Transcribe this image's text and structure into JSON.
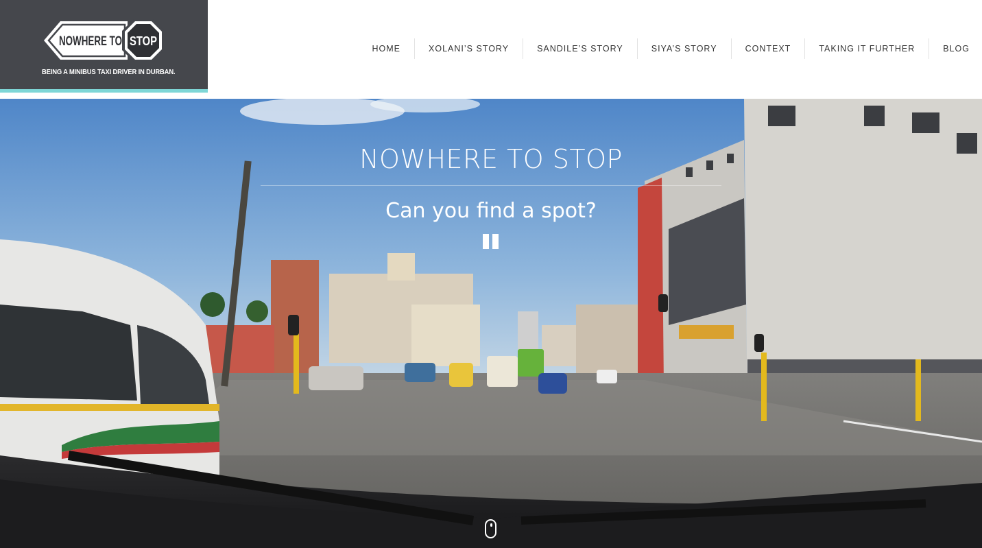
{
  "logo": {
    "sign_text_left": "NOWHERE TO",
    "sign_text_right": "STOP",
    "tagline": "BEING A MINIBUS TAXI DRIVER IN DURBAN.",
    "background_color": "#45474c",
    "accent_color": "#7ed6d6"
  },
  "nav": {
    "items": [
      {
        "label": "HOME"
      },
      {
        "label": "XOLANI’S STORY"
      },
      {
        "label": "SANDILE’S STORY"
      },
      {
        "label": "SIYA’S STORY"
      },
      {
        "label": "CONTEXT"
      },
      {
        "label": "TAKING IT FURTHER"
      },
      {
        "label": "BLOG"
      }
    ]
  },
  "hero": {
    "title": "NOWHERE TO STOP",
    "subtitle": "Can you find a spot?",
    "pause_icon": "pause-icon",
    "scroll_icon": "mouse-scroll-icon"
  }
}
